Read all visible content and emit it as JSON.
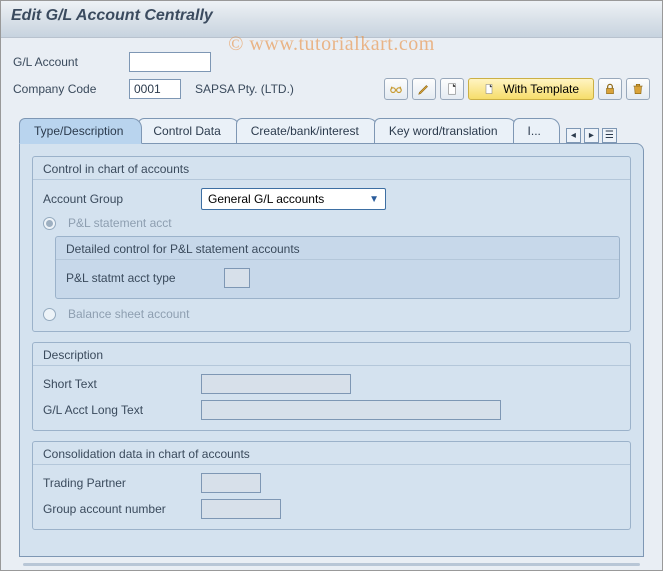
{
  "watermark": "© www.tutorialkart.com",
  "titlebar": {
    "title": "Edit G/L Account Centrally"
  },
  "header": {
    "gl_account_label": "G/L Account",
    "gl_account_value": "",
    "company_code_label": "Company Code",
    "company_code_value": "0001",
    "company_desc": "SAPSA Pty. (LTD.)"
  },
  "toolbar": {
    "display_tip": "Display",
    "edit_tip": "Edit",
    "copy_tip": "Copy",
    "new_template_tip": "New",
    "with_template_label": "With Template",
    "lock_tip": "Lock",
    "delete_tip": "Delete"
  },
  "tabs": {
    "t0": "Type/Description",
    "t1": "Control Data",
    "t2": "Create/bank/interest",
    "t3": "Key word/translation",
    "t4": "I..."
  },
  "panel": {
    "group1_title": "Control in chart of accounts",
    "account_group_label": "Account Group",
    "account_group_value": "General G/L accounts",
    "radio_pl_label": "P&L statement acct",
    "nested_title": "Detailed control for P&L statement accounts",
    "pl_type_label": "P&L statmt acct type",
    "pl_type_value": "",
    "radio_bs_label": "Balance sheet account",
    "group2_title": "Description",
    "short_text_label": "Short Text",
    "short_text_value": "",
    "long_text_label": "G/L Acct Long Text",
    "long_text_value": "",
    "group3_title": "Consolidation data in chart of accounts",
    "trading_partner_label": "Trading Partner",
    "trading_partner_value": "",
    "group_acc_label": "Group account number",
    "group_acc_value": ""
  }
}
